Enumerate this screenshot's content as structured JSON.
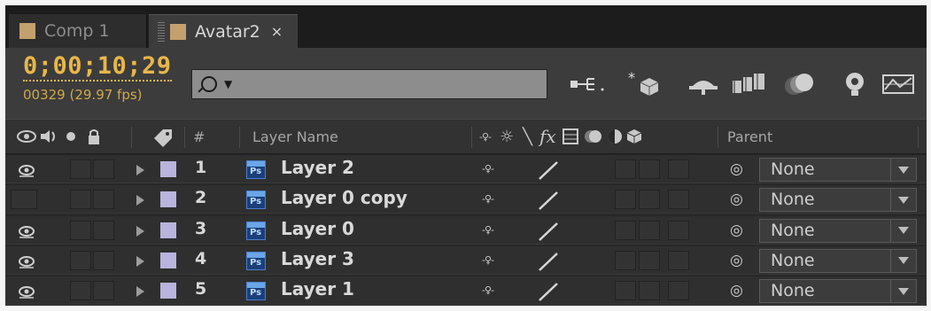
{
  "tabs": [
    {
      "label": "Comp 1"
    },
    {
      "label": "Avatar2",
      "close": "×"
    }
  ],
  "header": {
    "timecode": "0;00;10;29",
    "frame_info": "00329 (29.97 fps)",
    "search": {
      "value": "",
      "placeholder": ""
    }
  },
  "columns": {
    "layer_name": "Layer Name",
    "number": "#",
    "fx": "fx",
    "parent": "Parent"
  },
  "layers": [
    {
      "index": "1",
      "name": "Layer 2",
      "visible": true,
      "ps_label": "Ps",
      "parent": "None"
    },
    {
      "index": "2",
      "name": "Layer 0 copy",
      "visible": false,
      "ps_label": "Ps",
      "parent": "None"
    },
    {
      "index": "3",
      "name": "Layer 0",
      "visible": true,
      "ps_label": "Ps",
      "parent": "None"
    },
    {
      "index": "4",
      "name": "Layer 3",
      "visible": true,
      "ps_label": "Ps",
      "parent": "None"
    },
    {
      "index": "5",
      "name": "Layer 1",
      "visible": true,
      "ps_label": "Ps",
      "parent": "None"
    }
  ],
  "colors": {
    "timecode": "#e8b64a",
    "label_swatch": "#b8b4dd",
    "comp_swatch": "#c3a06e"
  },
  "icons": [
    "eye-icon",
    "audio-icon",
    "solo-icon",
    "lock-icon",
    "label-tag-icon",
    "shy-icon",
    "collapse-icon",
    "quality-icon",
    "fx-icon",
    "motion-blur-icon",
    "adjustment-icon",
    "3d-icon",
    "parent-pickwhip-icon"
  ]
}
